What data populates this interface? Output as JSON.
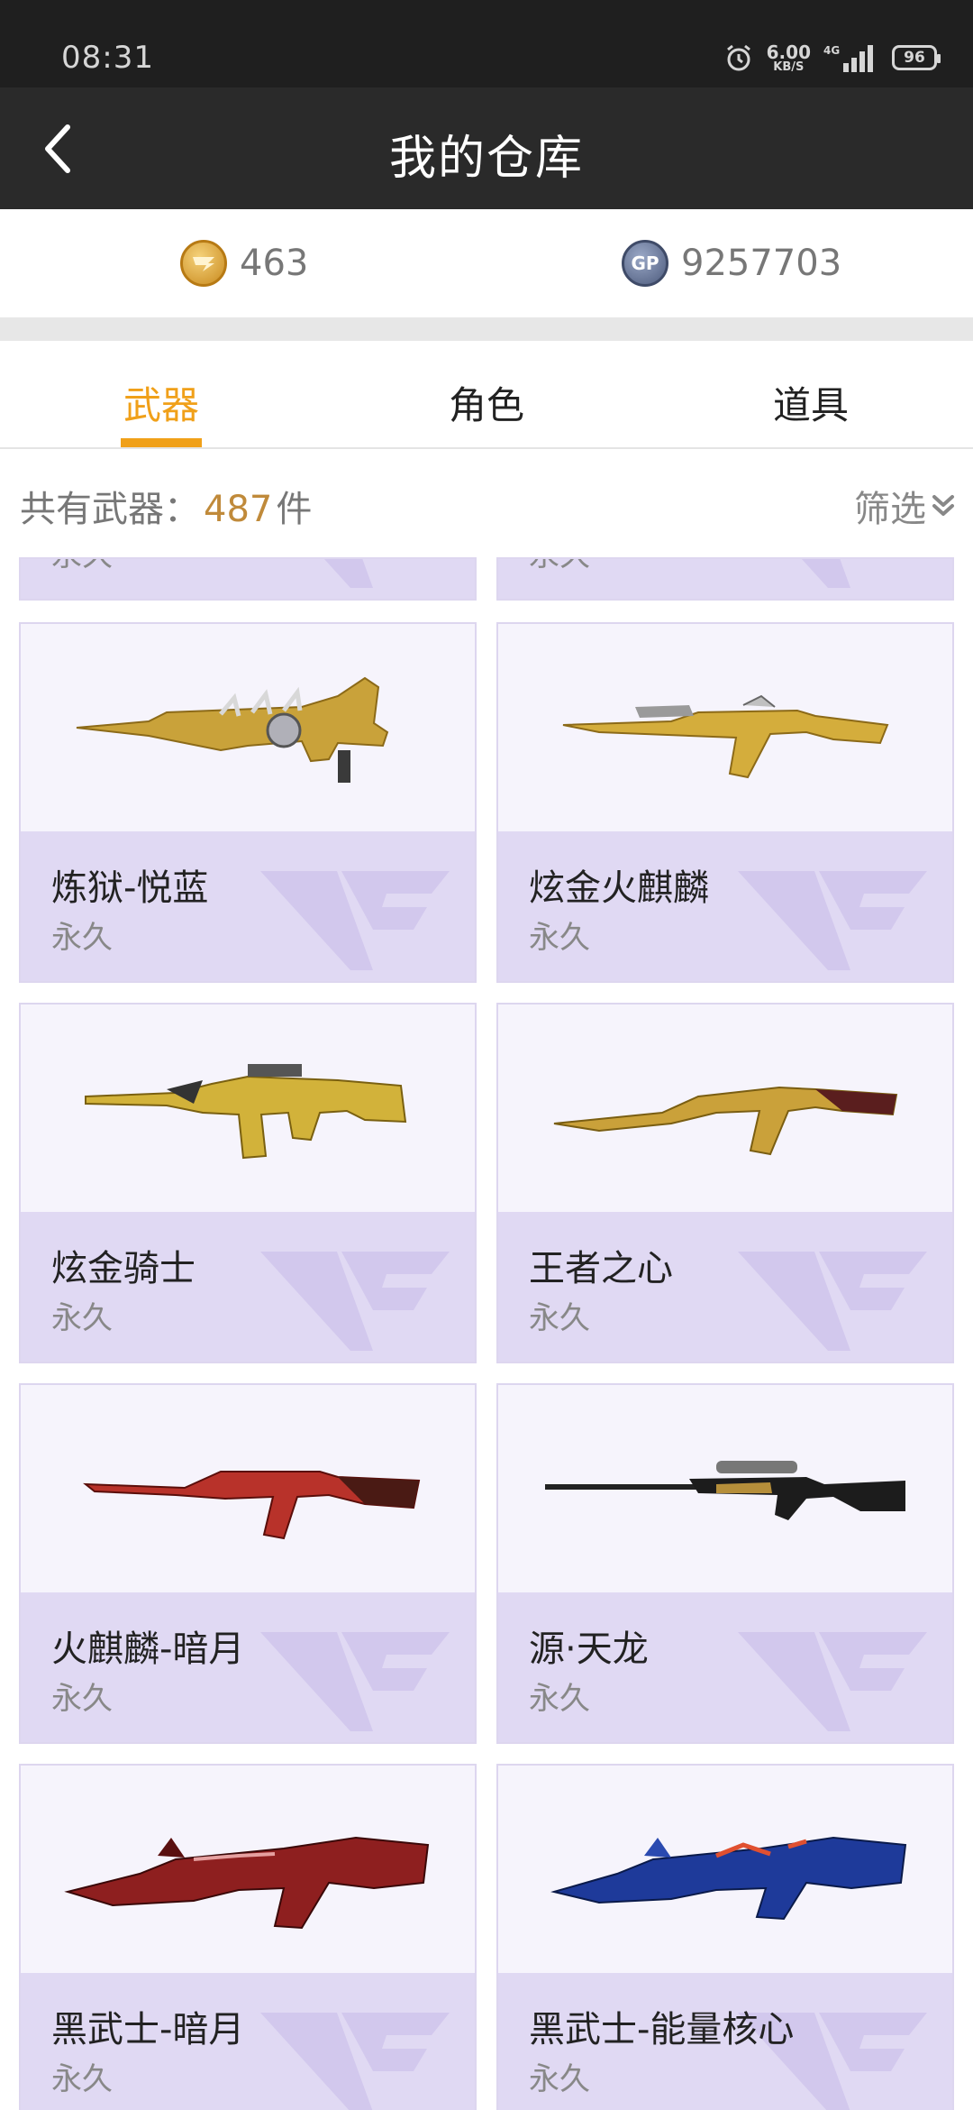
{
  "status": {
    "time": "08:31",
    "net_speed": "6.00",
    "net_unit": "KB/S",
    "network": "4G",
    "battery": "96"
  },
  "nav": {
    "title": "我的仓库"
  },
  "currency": {
    "cf_points": "463",
    "gp": "9257703"
  },
  "tabs": [
    {
      "label": "武器",
      "active": true
    },
    {
      "label": "角色"
    },
    {
      "label": "道具"
    }
  ],
  "summary": {
    "prefix": "共有武器：",
    "count": "487",
    "unit": "件",
    "filter_label": "筛选"
  },
  "partial_cards": [
    {
      "duration": "永久"
    },
    {
      "duration": "永久"
    }
  ],
  "items": [
    {
      "name": "炼狱-悦蓝",
      "duration": "永久"
    },
    {
      "name": "炫金火麒麟",
      "duration": "永久"
    },
    {
      "name": "炫金骑士",
      "duration": "永久"
    },
    {
      "name": "王者之心",
      "duration": "永久"
    },
    {
      "name": "火麒麟-暗月",
      "duration": "永久"
    },
    {
      "name": "源·天龙",
      "duration": "永久"
    },
    {
      "name": "黑武士-暗月",
      "duration": "永久"
    },
    {
      "name": "黑武士-能量核心",
      "duration": "永久"
    }
  ]
}
